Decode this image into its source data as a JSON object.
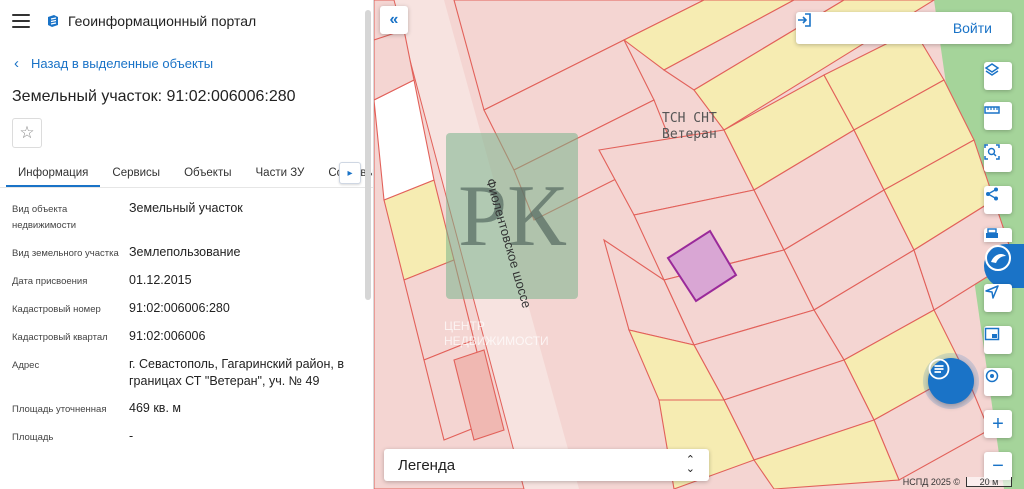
{
  "header": {
    "title": "Геоинформационный портал"
  },
  "back_link": {
    "label": "Назад в выделенные объекты"
  },
  "object": {
    "title": "Земельный участок: 91:02:006006:280"
  },
  "tabs": [
    {
      "label": "Информация",
      "active": true
    },
    {
      "label": "Сервисы"
    },
    {
      "label": "Объекты"
    },
    {
      "label": "Части ЗУ"
    },
    {
      "label": "Составы"
    }
  ],
  "properties": [
    {
      "label": "Вид объекта недвижимости",
      "value": "Земельный участок"
    },
    {
      "label": "Вид земельного участка",
      "value": "Землепользование"
    },
    {
      "label": "Дата присвоения",
      "value": "01.12.2015"
    },
    {
      "label": "Кадастровый номер",
      "value": "91:02:006006:280"
    },
    {
      "label": "Кадастровый квартал",
      "value": "91:02:006006"
    },
    {
      "label": "Адрес",
      "value": "г. Севастополь, Гагаринский район, в границах СТ \"Ветеран\", уч. № 49"
    },
    {
      "label": "Площадь уточненная",
      "value": "469 кв. м"
    },
    {
      "label": "Площадь",
      "value": "-"
    }
  ],
  "map": {
    "login_label": "Войти",
    "legend_label": "Легенда",
    "street_label": "Фиолентовское шоссе",
    "area_label_line1": "ТСН СНТ",
    "area_label_line2": "Ветеран",
    "watermark_line1": "ЦЕНТР",
    "watermark_line2": "НЕДВИЖИМОСТИ",
    "watermark_letters": "РК",
    "attribution": "НСПД 2025 ©",
    "scale_label": "20 м",
    "colors": {
      "parcel_fill": "#f5d0cc",
      "parcel_stroke": "#e2615a",
      "yellow_fill": "#f6ecb2",
      "selected_fill": "#d9a6d4",
      "selected_stroke": "#9a2a9a",
      "green": "#a5d49a",
      "accent": "#1a73c7"
    }
  },
  "icons": {
    "menu": "hamburger-icon",
    "logo": "portal-logo-icon",
    "star": "star-icon",
    "layers": "layers-icon",
    "ruler": "ruler-icon",
    "select": "area-select-icon",
    "share": "share-icon",
    "print": "printer-icon",
    "locate": "navigation-arrow-icon",
    "minimap": "minimap-icon",
    "search_location": "map-search-icon",
    "zoom_in": "plus-icon",
    "zoom_out": "minus-icon",
    "chat": "chat-icon"
  }
}
